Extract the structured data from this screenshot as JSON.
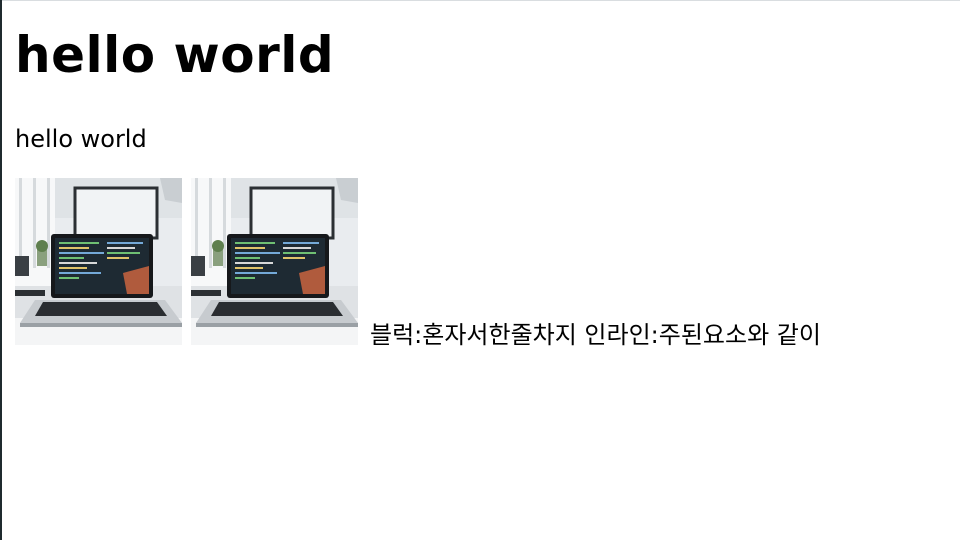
{
  "heading": "hello world",
  "paragraph": "hello world",
  "images": [
    {
      "alt": "laptop-photo"
    },
    {
      "alt": "laptop-photo"
    }
  ],
  "caption": "블럭:혼자서한줄차지 인라인:주된요소와 같이"
}
